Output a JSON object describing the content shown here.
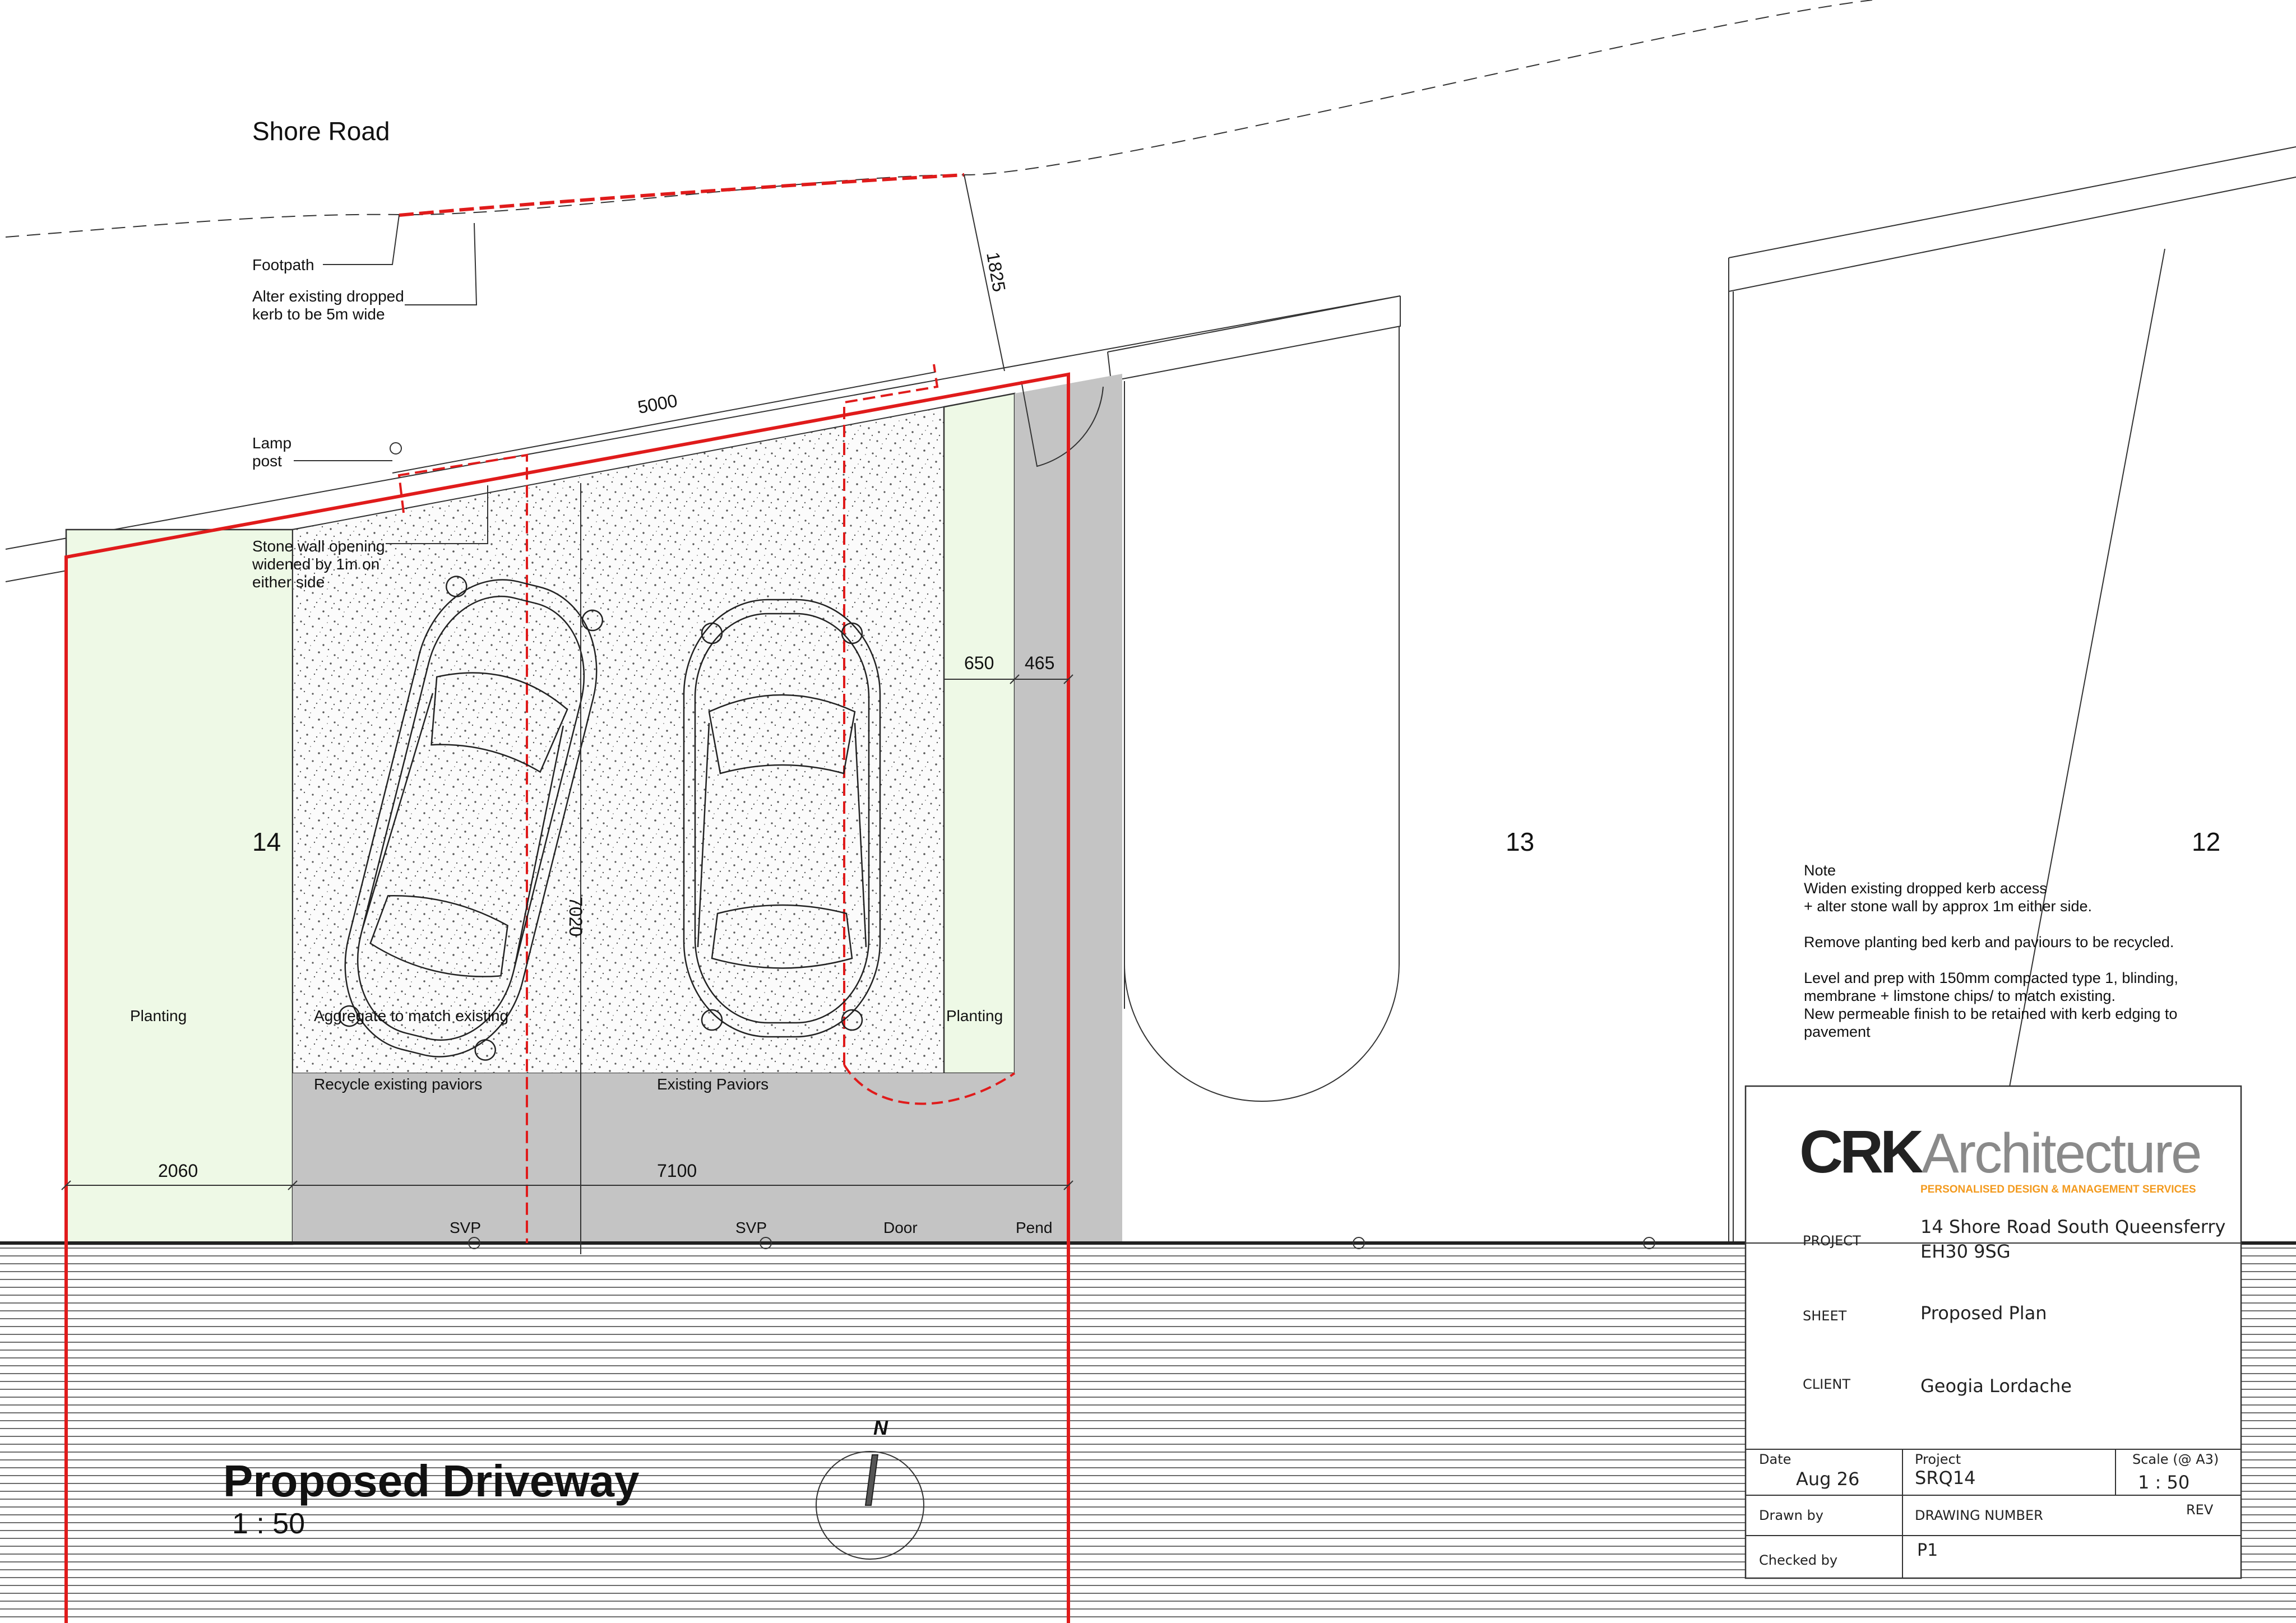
{
  "road": {
    "name": "Shore Road",
    "footpath_label": "Footpath",
    "kerb_note_line1": "Alter existing dropped",
    "kerb_note_line2": "kerb to be 5m wide"
  },
  "annotations": {
    "lamp_line1": "Lamp",
    "lamp_line2": "post",
    "stone_wall_line1": "Stone wall opening",
    "stone_wall_line2": "widened by 1m on",
    "stone_wall_line3": "either side",
    "planting_left": "Planting",
    "planting_right": "Planting",
    "aggregate": "Aggregate to match existing",
    "recycle_paviors": "Recycle existing paviors",
    "existing_paviors": "Existing Paviors",
    "svp_1": "SVP",
    "svp_2": "SVP",
    "door": "Door",
    "pend": "Pend"
  },
  "house_numbers": {
    "left": "14",
    "middle": "13",
    "right": "12"
  },
  "dimensions": {
    "d1825": "1825",
    "d5000": "5000",
    "d650": "650",
    "d465": "465",
    "d7020": "7020",
    "d2060": "2060",
    "d7100": "7100"
  },
  "notes": {
    "heading": "Note",
    "line1": "Widen existing dropped kerb access",
    "line2": "+ alter stone wall by approx 1m either side.",
    "line3": "Remove planting bed kerb and paviours to be recycled.",
    "line4": "Level and prep with 150mm compacted type 1, blinding,",
    "line5": "membrane + limstone chips/ to match existing.",
    "line6": "New permeable finish to be retained with kerb edging to",
    "line7": "pavement"
  },
  "drawing": {
    "title": "Proposed Driveway",
    "scale": "1 : 50",
    "north": "N"
  },
  "title_block": {
    "logo_main": "CRK",
    "logo_rest": "Architecture",
    "tagline": "PERSONALISED DESIGN & MANAGEMENT SERVICES",
    "project_label": "PROJECT",
    "project_line1": "14 Shore Road South Queensferry",
    "project_line2": "EH30 9SG",
    "sheet_label": "SHEET",
    "sheet_value": "Proposed Plan",
    "client_label": "CLIENT",
    "client_value": "Geogia Lordache",
    "date_label": "Date",
    "date_value": "Aug 26",
    "project_no_label": "Project",
    "project_no_value": "SRQ14",
    "scale_label": "Scale (@ A3)",
    "scale_value": "1 : 50",
    "drawn_by_label": "Drawn by",
    "drawing_number_label": "DRAWING NUMBER",
    "rev_label": "REV",
    "checked_by_label": "Checked by",
    "drawing_number_value": "P1"
  },
  "colors": {
    "boundary_red": "#e01b1b",
    "planting_green": "#eef9e6",
    "paviors_grey": "#c4c4c4",
    "logo_grey": "#8a8a8a",
    "logo_orange": "#f39a1e"
  }
}
